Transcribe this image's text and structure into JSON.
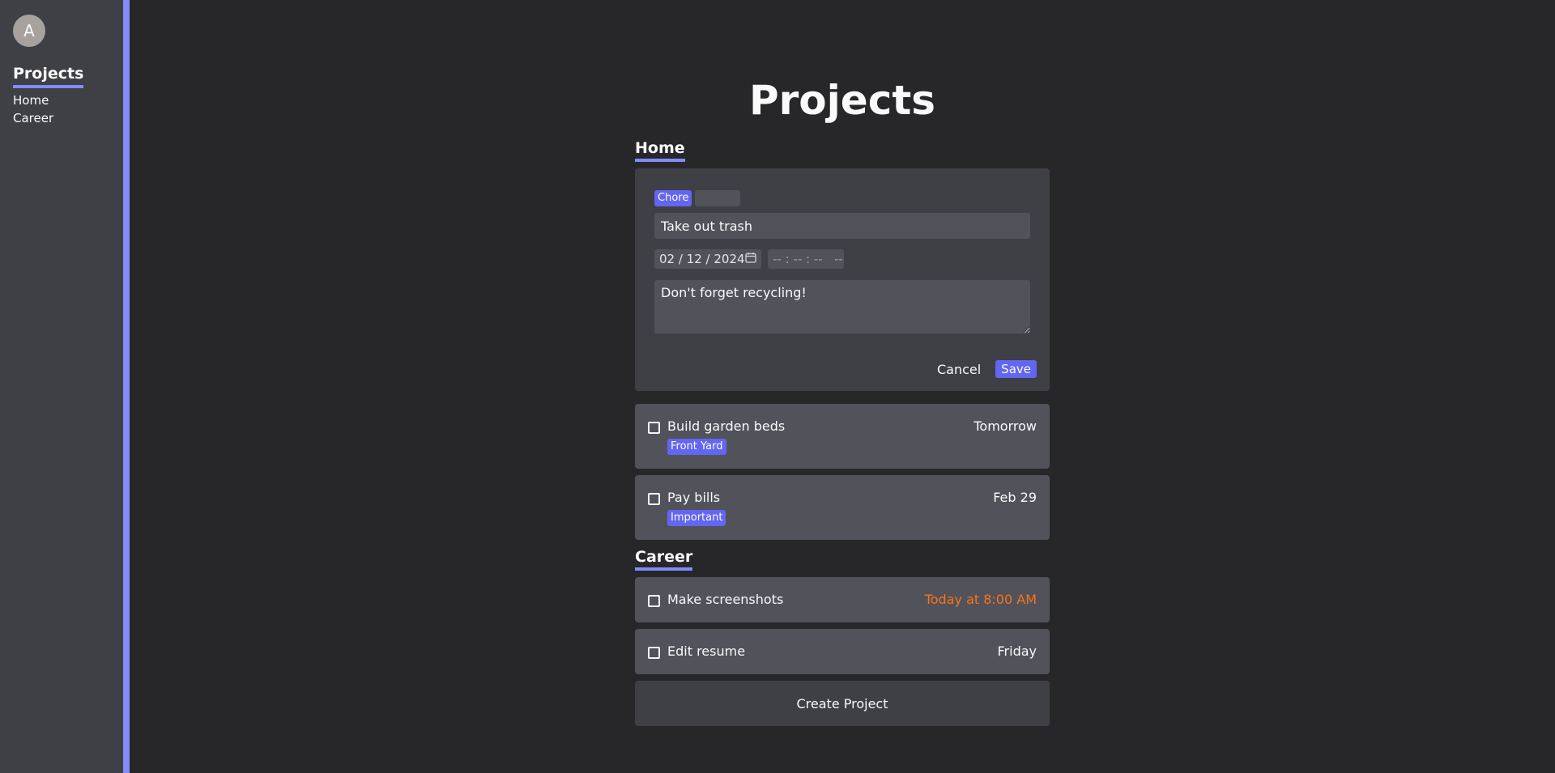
{
  "sidebar": {
    "avatar_initial": "A",
    "title": "Projects",
    "links": [
      "Home",
      "Career"
    ]
  },
  "main": {
    "title": "Projects",
    "sections": [
      {
        "title": "Home",
        "editor": {
          "tag": "Chore",
          "title_value": "Take out trash",
          "date_value": "02 / 12 / 2024",
          "time_value": "-- : -- : --   --",
          "notes_value": "Don't forget recycling!",
          "cancel_label": "Cancel",
          "save_label": "Save"
        },
        "tasks": [
          {
            "title": "Build garden beds",
            "due": "Tomorrow",
            "tag": "Front Yard"
          },
          {
            "title": "Pay bills",
            "due": "Feb 29",
            "tag": "Important"
          }
        ]
      },
      {
        "title": "Career",
        "tasks": [
          {
            "title": "Make screenshots",
            "due": "Today at 8:00 AM",
            "due_color": "#f97316"
          },
          {
            "title": "Edit resume",
            "due": "Friday"
          }
        ]
      }
    ],
    "create_label": "Create Project"
  },
  "colors": {
    "accent": "#818cf8",
    "tag": "#6366f1",
    "urgent": "#f97316",
    "background": "#27272a",
    "panel": "#3f3f46",
    "card": "#52525b"
  },
  "icons": {
    "calendar": "calendar-icon",
    "checkbox": "checkbox"
  }
}
